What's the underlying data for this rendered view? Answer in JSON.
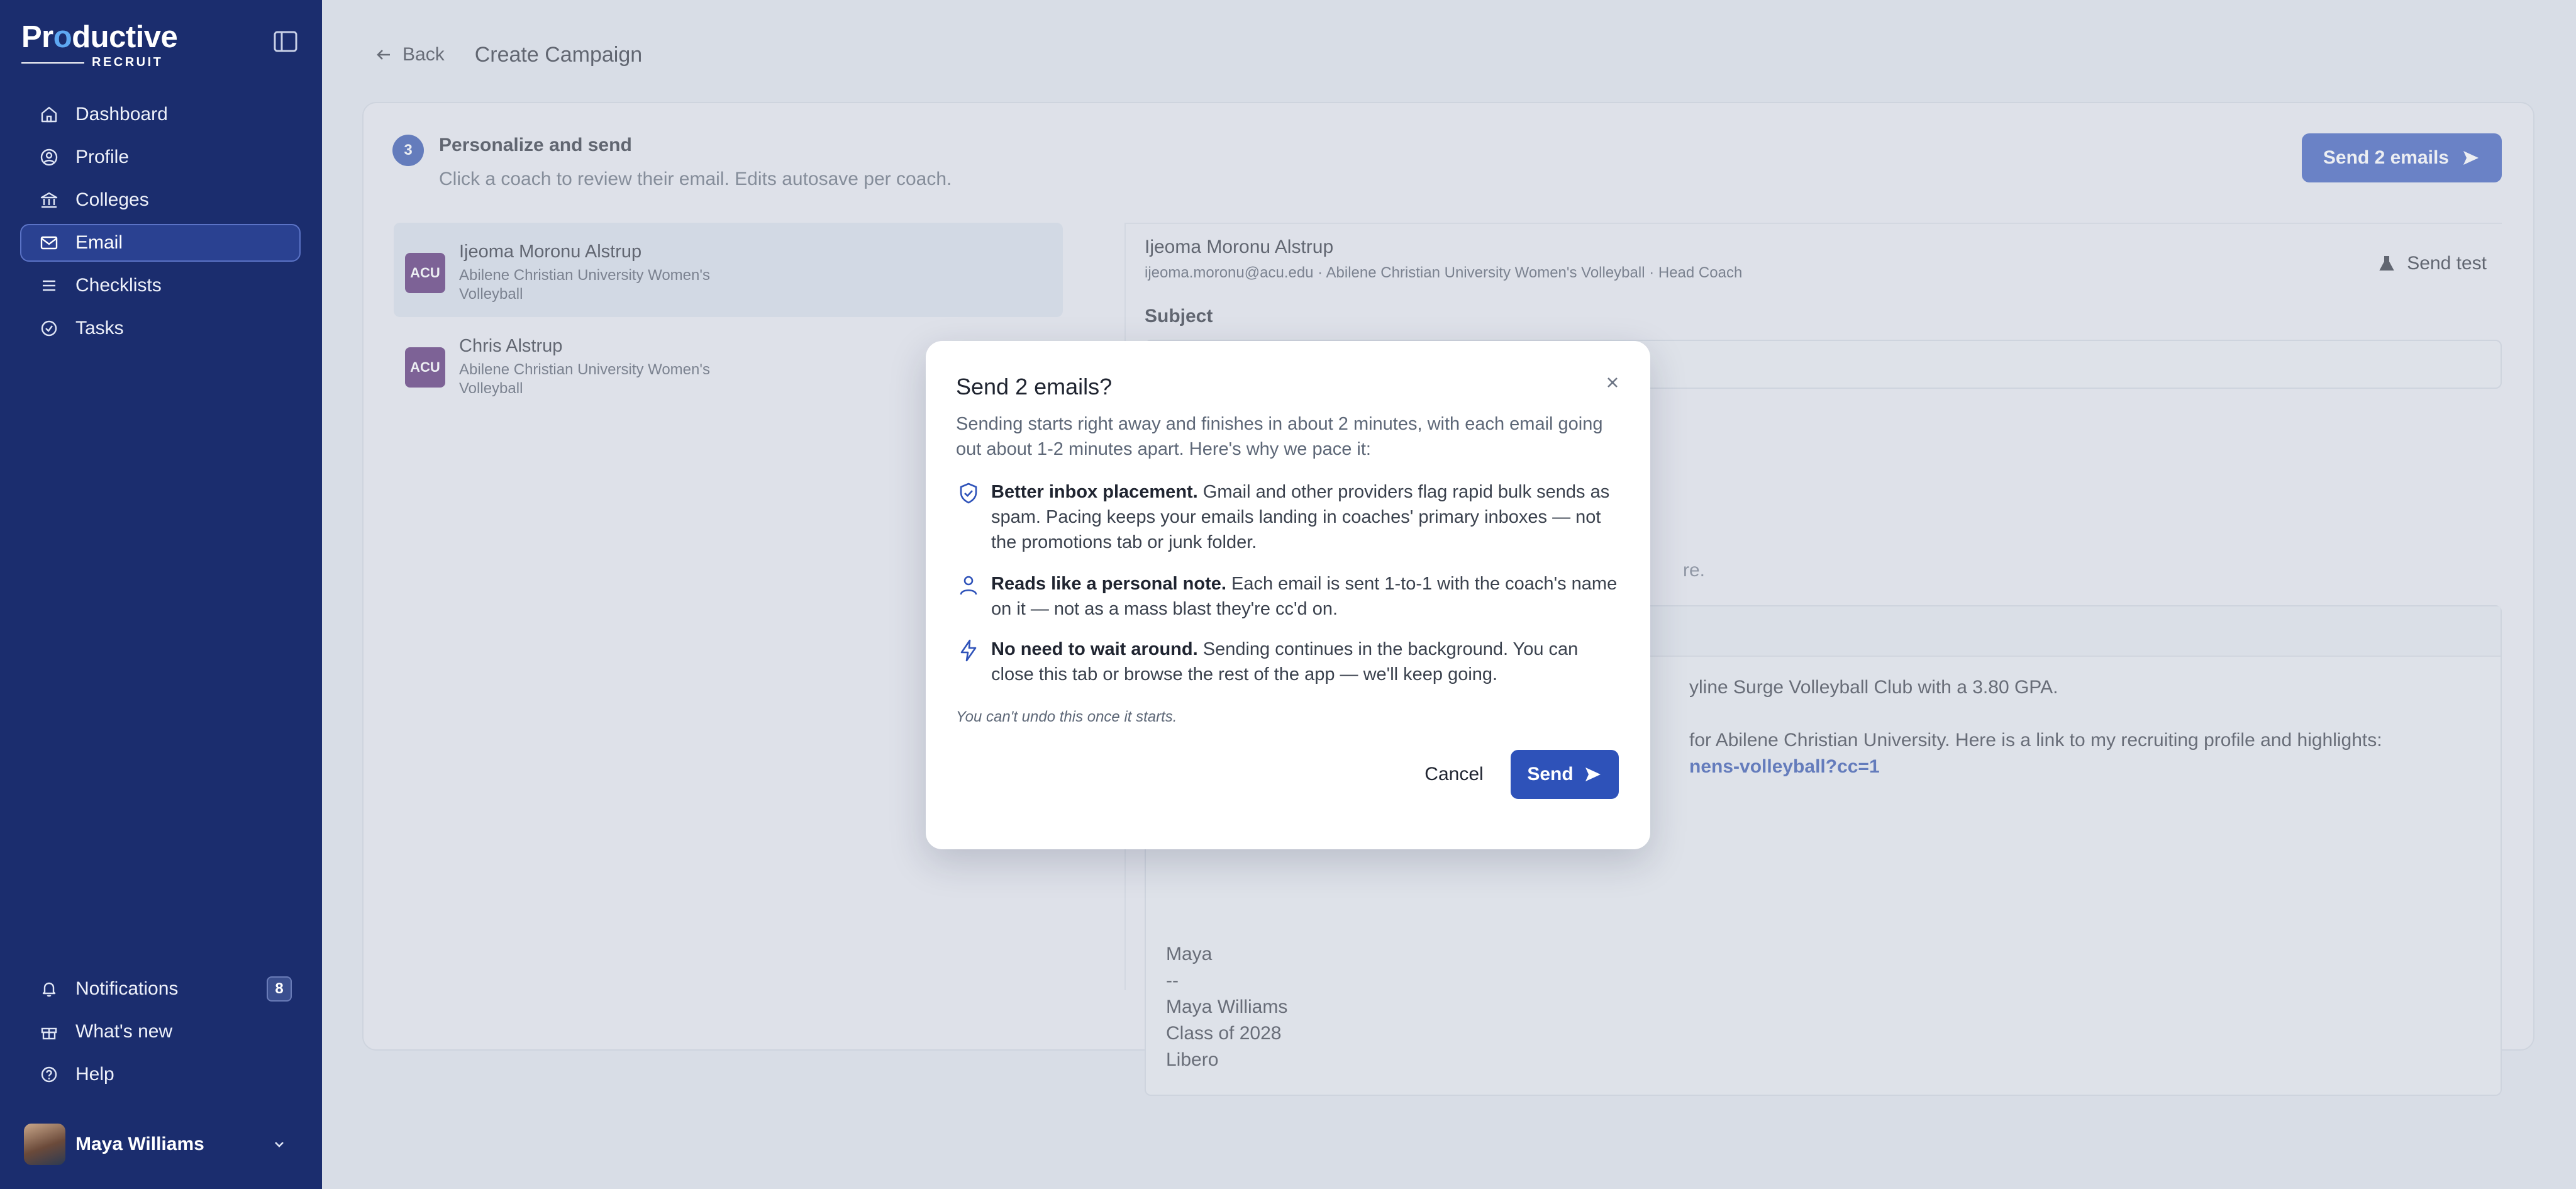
{
  "brand": {
    "name_pre": "Pr",
    "name_o": "o",
    "name_post": "ductive",
    "sub": "RECRUIT"
  },
  "sidebar": {
    "items": [
      {
        "label": "Dashboard",
        "icon": "home-icon"
      },
      {
        "label": "Profile",
        "icon": "user-circle-icon"
      },
      {
        "label": "Colleges",
        "icon": "building-icon"
      },
      {
        "label": "Email",
        "icon": "mail-icon",
        "active": true
      },
      {
        "label": "Checklists",
        "icon": "list-icon"
      },
      {
        "label": "Tasks",
        "icon": "check-circle-icon"
      }
    ],
    "bottom": [
      {
        "label": "Notifications",
        "icon": "bell-icon",
        "badge": "8"
      },
      {
        "label": "What's new",
        "icon": "gift-icon"
      },
      {
        "label": "Help",
        "icon": "help-icon"
      }
    ],
    "user": {
      "name": "Maya Williams"
    }
  },
  "header": {
    "back_label": "Back",
    "title": "Create Campaign"
  },
  "step": {
    "number": "3",
    "title": "Personalize and send",
    "subtitle": "Click a coach to review their email. Edits autosave per coach.",
    "send_all_label": "Send 2 emails"
  },
  "coaches": [
    {
      "name": "Ijeoma Moronu Alstrup",
      "school_line1": "Abilene Christian University Women's",
      "school_line2": "Volleyball",
      "logo": "ACU"
    },
    {
      "name": "Chris Alstrup",
      "school_line1": "Abilene Christian University Women's",
      "school_line2": "Volleyball",
      "logo": "ACU"
    }
  ],
  "detail": {
    "name": "Ijeoma Moronu Alstrup",
    "meta": "ijeoma.moronu@acu.edu · Abilene Christian University Women's Volleyball · Head Coach",
    "send_test_label": "Send test",
    "subject_label": "Subject",
    "hint_tail": "re.",
    "body_line1_tail": "yline Surge Volleyball Club with a 3.80 GPA.",
    "body_line2_tail": "for Abilene Christian University. Here is a link to my recruiting profile and highlights:",
    "body_link_tail": "nens-volleyball?cc=1",
    "signature": [
      "Maya",
      "--",
      "Maya Williams",
      "Class of 2028",
      "Libero"
    ]
  },
  "dialog": {
    "title": "Send 2 emails?",
    "intro": "Sending starts right away and finishes in about 2 minutes, with each email going out about 1-2 minutes apart. Here's why we pace it:",
    "reasons": [
      {
        "title": "Better inbox placement.",
        "text": " Gmail and other providers flag rapid bulk sends as spam. Pacing keeps your emails landing in coaches' primary inboxes — not the promotions tab or junk folder.",
        "icon": "shield-check-icon"
      },
      {
        "title": "Reads like a personal note.",
        "text": " Each email is sent 1-to-1 with the coach's name on it — not as a mass blast they're cc'd on.",
        "icon": "person-icon"
      },
      {
        "title": "No need to wait around.",
        "text": " Sending continues in the background. You can close this tab or browse the rest of the app — we'll keep going.",
        "icon": "bolt-icon"
      }
    ],
    "warning": "You can't undo this once it starts.",
    "cancel_label": "Cancel",
    "send_label": "Send"
  },
  "colors": {
    "sidebar": "#1b2d6e",
    "accent": "#2e52b9",
    "logo_dot": "#5ea8f2"
  }
}
